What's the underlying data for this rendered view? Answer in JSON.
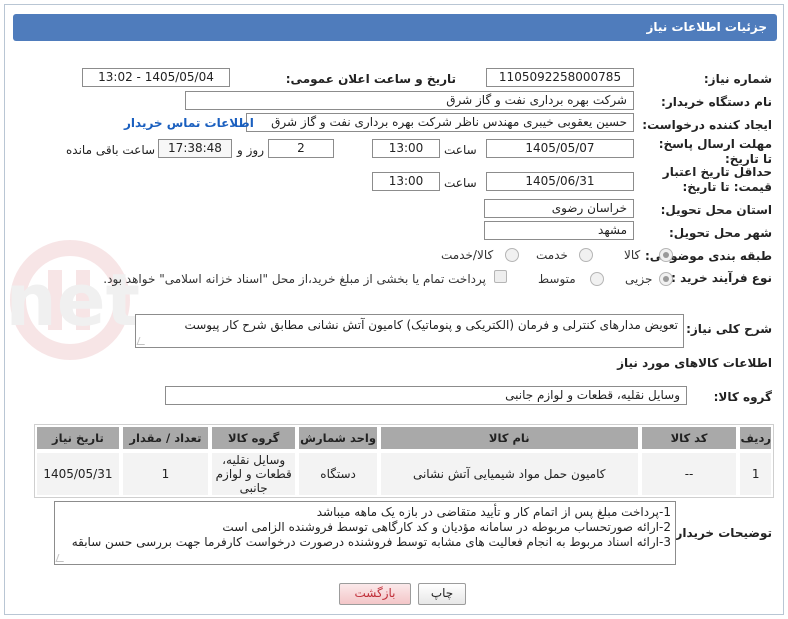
{
  "header": {
    "title": "جزئیات اطلاعات نیاز"
  },
  "fields": {
    "need_number_label": "شماره نیاز:",
    "need_number": "1105092258000785",
    "announce_label": "تاریخ و ساعت اعلان عمومی:",
    "announce_value": "1405/05/04 - 13:02",
    "buyer_org_label": "نام دستگاه خریدار:",
    "buyer_org": "شرکت بهره برداری نفت و گاز شرق",
    "requester_label": "ایجاد کننده درخواست:",
    "requester": "حسین یعقوبی خیبری مهندس ناظر شرکت بهره برداری نفت و گاز شرق",
    "contact_link": "اطلاعات تماس خریدار",
    "reply_deadline_label": "مهلت ارسال پاسخ: تا تاریخ:",
    "reply_date": "1405/05/07",
    "time_label": "ساعت",
    "reply_time": "13:00",
    "days_value": "2",
    "days_label": "روز و",
    "remaining_time": "17:38:48",
    "remaining_label": "ساعت باقی مانده",
    "price_validity_label": "حداقل تاریخ اعتبار قیمت: تا تاریخ:",
    "price_date": "1405/06/31",
    "price_time": "13:00",
    "province_label": "استان محل تحویل:",
    "province": "خراسان رضوی",
    "city_label": "شهر محل تحویل:",
    "city": "مشهد",
    "category_label": "طبقه بندی موضوعی:",
    "category_options": [
      "کالا",
      "خدمت",
      "کالا/خدمت"
    ],
    "process_label": "نوع فرآیند خرید :",
    "process_options": [
      "جزیی",
      "متوسط"
    ],
    "payment_note": "پرداخت تمام یا بخشی از مبلغ خرید،از محل \"اسناد خزانه اسلامی\" خواهد بود.",
    "description_label": "شرح کلی نیاز:",
    "description": "تعویض مدارهای کنترلی و فرمان (الکتریکی و پنوماتیک) کامیون آتش نشانی مطابق شرح کار پیوست",
    "goods_info_title": "اطلاعات کالاهای مورد نیاز",
    "goods_group_label": "گروه کالا:",
    "goods_group": "وسایل نقلیه، قطعات و لوازم جانبی"
  },
  "table": {
    "headers": [
      "ردیف",
      "کد کالا",
      "نام کالا",
      "واحد شمارش",
      "گروه کالا",
      "تعداد / مقدار",
      "تاریخ نیاز"
    ],
    "rows": [
      [
        "1",
        "--",
        "کامیون حمل مواد شیمیایی آتش نشانی",
        "دستگاه",
        "وسایل نقلیه، قطعات و لوازم جانبی",
        "1",
        "1405/05/31"
      ]
    ]
  },
  "buyer_notes": {
    "label": "توضیحات خریدار:",
    "lines": [
      "1-پرداخت مبلغ پس از اتمام کار و تأیید متقاضی در بازه یک ماهه میباشد",
      "2-ارائه صورتحساب مربوطه در سامانه مؤدیان و کد کارگاهی توسط فروشنده الزامی است",
      "3-ارائه اسناد مربوط به انجام فعالیت های مشابه توسط فروشنده درصورت درخواست کارفرما جهت بررسی حسن سابقه"
    ]
  },
  "buttons": {
    "print": "چاپ",
    "back": "بازگشت"
  },
  "watermark": "AriaTender.net"
}
